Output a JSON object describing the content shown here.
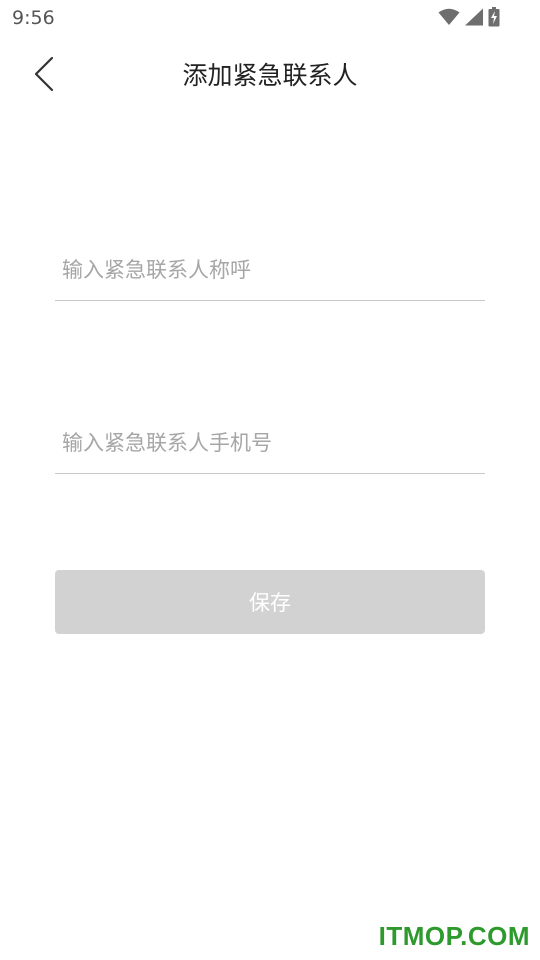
{
  "status_bar": {
    "time": "9:56",
    "icons": [
      "wifi-icon",
      "cellular-signal-icon",
      "battery-charging-icon"
    ]
  },
  "header": {
    "back_icon": "chevron-left-icon",
    "title": "添加紧急联系人"
  },
  "form": {
    "name_field": {
      "value": "",
      "placeholder": "输入紧急联系人称呼"
    },
    "phone_field": {
      "value": "",
      "placeholder": "输入紧急联系人手机号"
    },
    "save_label": "保存"
  },
  "watermark": "ITMOP.COM",
  "colors": {
    "button_disabled_bg": "#d2d2d2",
    "divider": "#c8c8c8",
    "placeholder": "#a6a6a6",
    "watermark": "#2e9a2e"
  }
}
